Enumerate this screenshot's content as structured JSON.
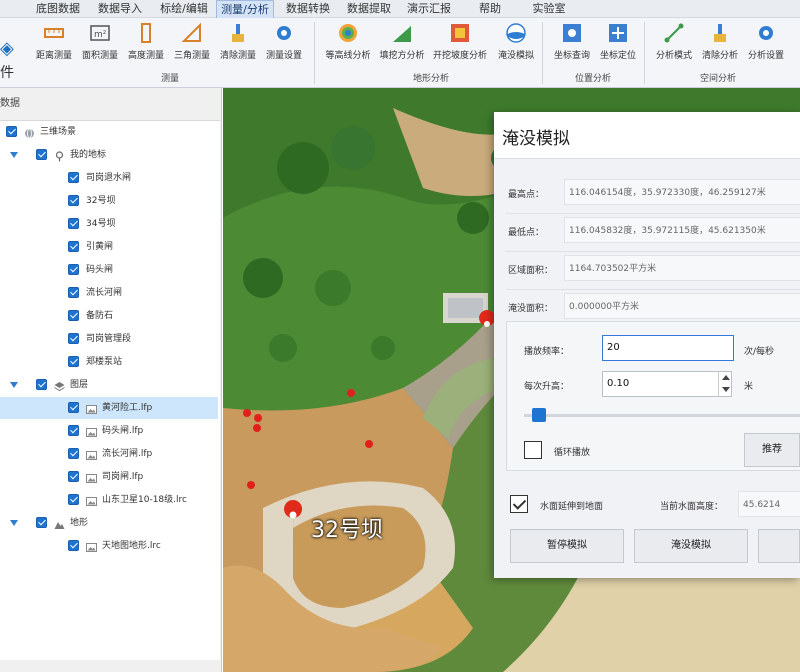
{
  "menu": {
    "items": [
      "底图数据",
      "数据导入",
      "标绘/编辑",
      "测量/分析",
      "数据转换",
      "数据提取",
      "演示汇报",
      "帮助",
      "实验室"
    ],
    "active_index": 3
  },
  "file_menu": {
    "label": "件"
  },
  "ribbon": {
    "groups": [
      {
        "label": "测量",
        "buttons": [
          "距离测量",
          "面积测量",
          "高度测量",
          "三角测量",
          "清除测量",
          "测量设置"
        ]
      },
      {
        "label": "地形分析",
        "buttons": [
          "等高线分析",
          "填挖方分析",
          "开挖坡度分析",
          "淹没模拟"
        ]
      },
      {
        "label": "位置分析",
        "buttons": [
          "坐标查询",
          "坐标定位"
        ]
      },
      {
        "label": "空间分析",
        "buttons": [
          "分析模式",
          "清除分析",
          "分析设置"
        ]
      }
    ]
  },
  "left_panel": {
    "title": "数据",
    "tree": [
      {
        "label": "三维场景",
        "icon": "globe-icon",
        "level": 0,
        "expander": false,
        "selected": false
      },
      {
        "label": "我的地标",
        "icon": "pin-icon",
        "level": 1,
        "expander": true,
        "selected": false
      },
      {
        "label": "司岗退水闸",
        "icon": "",
        "level": 2,
        "expander": false,
        "selected": false
      },
      {
        "label": "32号坝",
        "icon": "",
        "level": 2,
        "expander": false,
        "selected": false
      },
      {
        "label": "34号坝",
        "icon": "",
        "level": 2,
        "expander": false,
        "selected": false
      },
      {
        "label": "引黄闸",
        "icon": "",
        "level": 2,
        "expander": false,
        "selected": false
      },
      {
        "label": "码头闸",
        "icon": "",
        "level": 2,
        "expander": false,
        "selected": false
      },
      {
        "label": "流长河闸",
        "icon": "",
        "level": 2,
        "expander": false,
        "selected": false
      },
      {
        "label": "备防石",
        "icon": "",
        "level": 2,
        "expander": false,
        "selected": false
      },
      {
        "label": "司岗管理段",
        "icon": "",
        "level": 2,
        "expander": false,
        "selected": false
      },
      {
        "label": "郑楼泵站",
        "icon": "",
        "level": 2,
        "expander": false,
        "selected": false
      },
      {
        "label": "图层",
        "icon": "layers-icon",
        "level": 1,
        "expander": true,
        "selected": false
      },
      {
        "label": "黄河险工.lfp",
        "icon": "image-icon",
        "level": 2,
        "expander": false,
        "selected": true
      },
      {
        "label": "码头闸.lfp",
        "icon": "image-icon",
        "level": 2,
        "expander": false,
        "selected": false
      },
      {
        "label": "流长河闸.lfp",
        "icon": "image-icon",
        "level": 2,
        "expander": false,
        "selected": false
      },
      {
        "label": "司岗闸.lfp",
        "icon": "image-icon",
        "level": 2,
        "expander": false,
        "selected": false
      },
      {
        "label": "山东卫星10-18级.lrc",
        "icon": "image-icon",
        "level": 2,
        "expander": false,
        "selected": false
      },
      {
        "label": "地形",
        "icon": "terrain-icon",
        "level": 1,
        "expander": true,
        "selected": false
      },
      {
        "label": "天地图地形.lrc",
        "icon": "image-icon",
        "level": 2,
        "expander": false,
        "selected": false
      }
    ]
  },
  "scene": {
    "place_label": "32号坝"
  },
  "dialog": {
    "title": "淹没模拟",
    "rows": [
      {
        "label": "最高点：",
        "value": "116.046154度，35.972330度，46.259127米"
      },
      {
        "label": "最低点：",
        "value": "116.045832度，35.972115度，45.621350米"
      },
      {
        "label": "区域面积：",
        "value": "1164.703502平方米"
      },
      {
        "label": "淹没面积：",
        "value": "0.000000平方米"
      }
    ],
    "play_freq": {
      "label": "播放频率：",
      "value": "20",
      "unit": "次/每秒"
    },
    "rise_per_step": {
      "label": "每次升高：",
      "value": "0.10",
      "unit": "米"
    },
    "slider_level": 0.03,
    "loop_play": {
      "label": "循环播放",
      "checked": false
    },
    "push_button": "推荐",
    "extend_to_ground": {
      "label": "水面延伸到地面",
      "checked": true
    },
    "current_water": {
      "label": "当前水面高度：",
      "value": "45.6214"
    },
    "buttons": {
      "pause": "暂停模拟",
      "simulate": "淹没模拟"
    }
  }
}
